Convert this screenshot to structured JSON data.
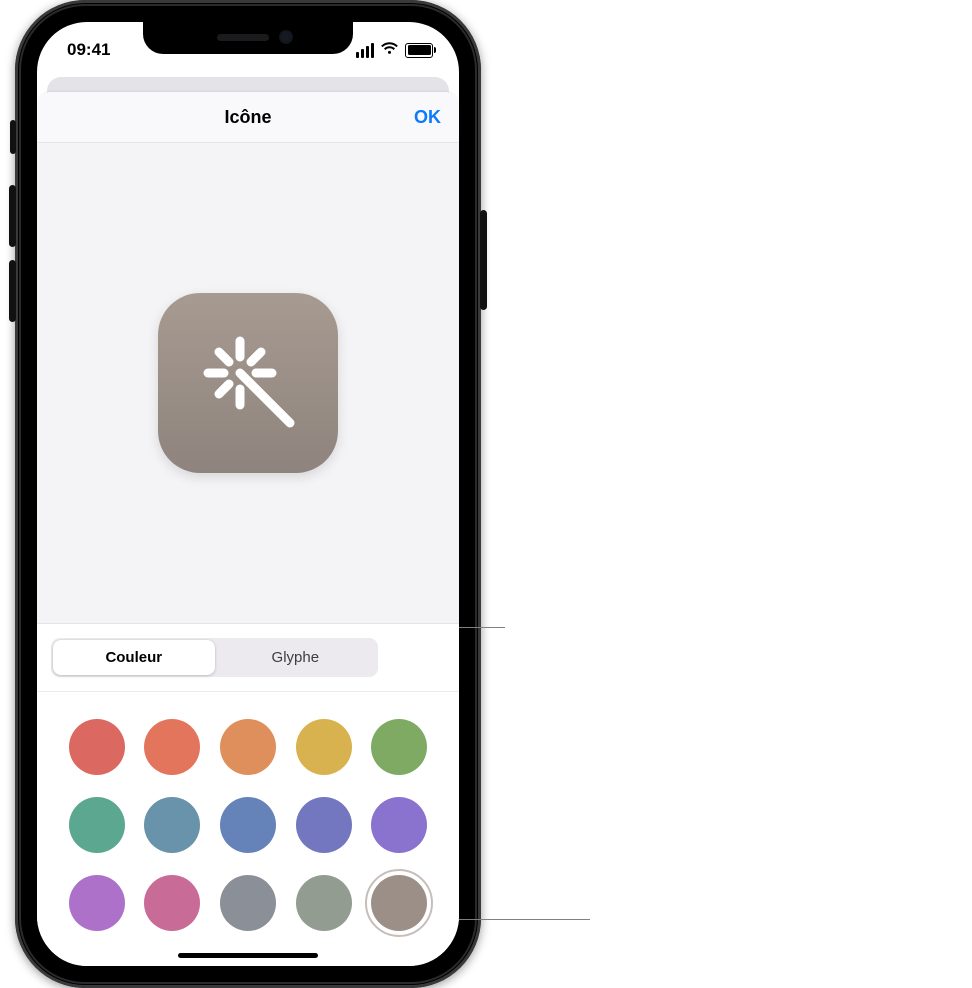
{
  "statusbar": {
    "time": "09:41"
  },
  "sheet": {
    "title": "Icône",
    "confirm_label": "OK"
  },
  "segmented": {
    "color": "Couleur",
    "glyph": "Glyphe",
    "selected": "color"
  },
  "preview": {
    "glyph_name": "magic-wand",
    "background_color": "#988d85"
  },
  "colors": [
    {
      "name": "red",
      "hex": "#dc6862",
      "selected": false
    },
    {
      "name": "coral",
      "hex": "#e3755d",
      "selected": false
    },
    {
      "name": "orange",
      "hex": "#df8f5b",
      "selected": false
    },
    {
      "name": "yellow",
      "hex": "#d8b24f",
      "selected": false
    },
    {
      "name": "green",
      "hex": "#7eaa64",
      "selected": false
    },
    {
      "name": "teal",
      "hex": "#5ba790",
      "selected": false
    },
    {
      "name": "steel-blue",
      "hex": "#6993ab",
      "selected": false
    },
    {
      "name": "blue",
      "hex": "#6583b8",
      "selected": false
    },
    {
      "name": "indigo",
      "hex": "#7277c0",
      "selected": false
    },
    {
      "name": "violet",
      "hex": "#8a72cf",
      "selected": false
    },
    {
      "name": "purple",
      "hex": "#ad71ca",
      "selected": false
    },
    {
      "name": "pink",
      "hex": "#c86c97",
      "selected": false
    },
    {
      "name": "slate",
      "hex": "#8a8f98",
      "selected": false
    },
    {
      "name": "sage",
      "hex": "#939c91",
      "selected": false
    },
    {
      "name": "taupe",
      "hex": "#9c8f87",
      "selected": true
    }
  ]
}
